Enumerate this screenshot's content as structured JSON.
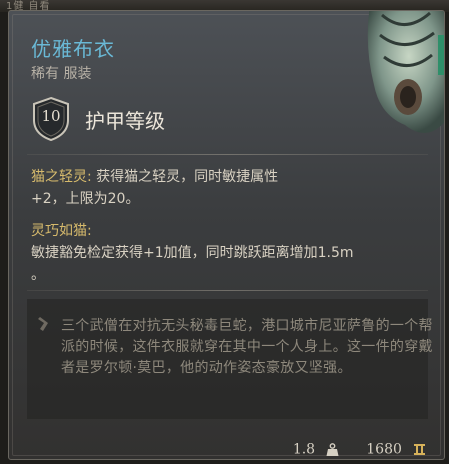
{
  "top_hint": "1健   自看",
  "item": {
    "name": "优雅布衣",
    "subtitle": "稀有 服装",
    "armor_class_value": "10",
    "armor_class_label": "护甲等级"
  },
  "passives": [
    {
      "title": "猫之轻灵:",
      "text_line1": " 获得猫之轻灵，同时敏捷属性",
      "text_line2": "+2，上限为20。"
    },
    {
      "title": "灵巧如猫:",
      "text_line1": "敏捷豁免检定获得+1加值，同时跳跃距离增加1.5m",
      "text_line2": "。"
    }
  ],
  "description": "三个武僧在对抗无头秘毒巨蛇，港口城市尼亚萨鲁的一个帮派的时候，这件衣服就穿在其中一个人身上。这一件的穿戴者是罗尔顿·莫巴，他的动作姿态豪放又坚强。",
  "footer": {
    "weight": "1.8",
    "value": "1680"
  },
  "colors": {
    "title": "#6ab9d6",
    "passive_title": "#d6ba6c",
    "text": "#d9d2c3",
    "description": "#8e887c"
  },
  "icons": [
    "shield-icon",
    "quote-icon",
    "weight-icon",
    "gold-coin-icon",
    "armor-art"
  ]
}
